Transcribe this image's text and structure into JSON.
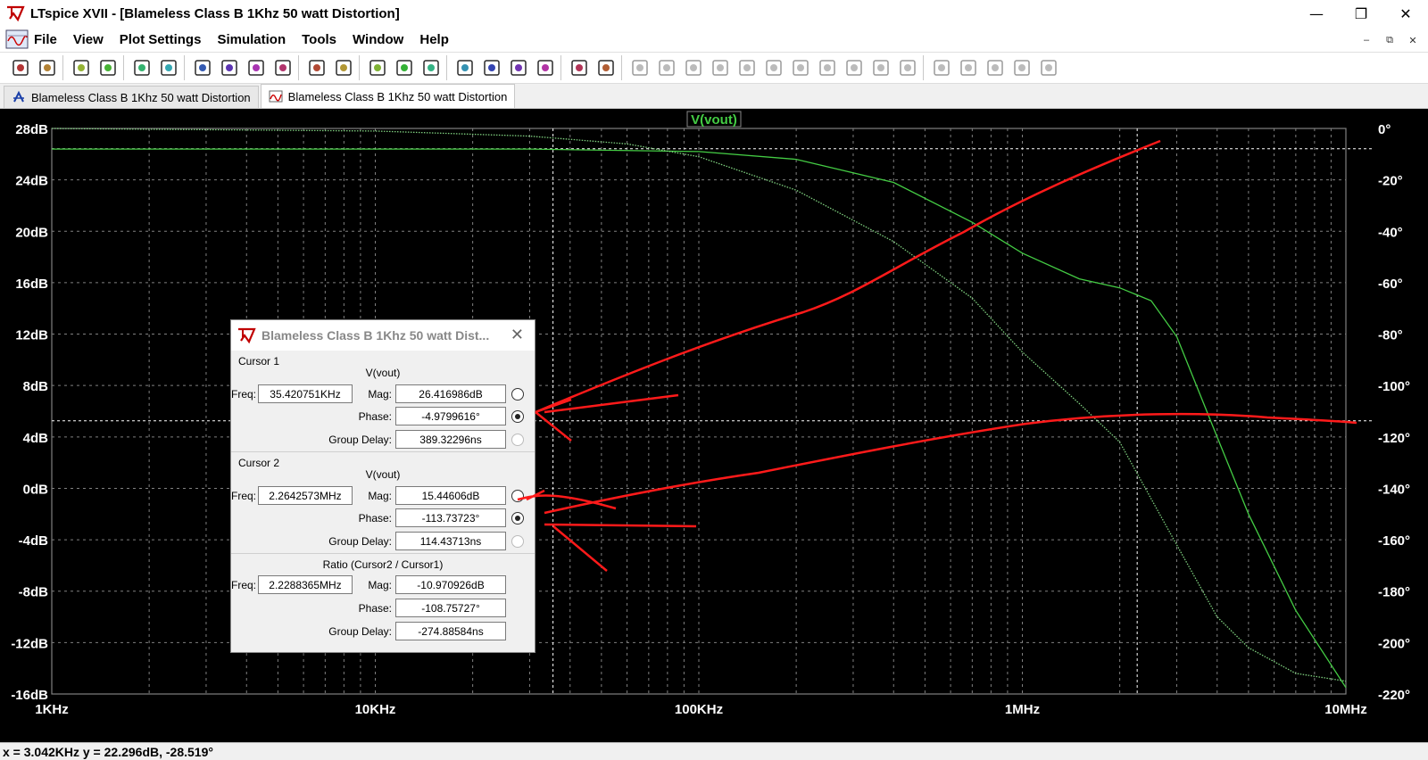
{
  "window": {
    "title": "LTspice XVII - [Blameless Class B 1Khz 50 watt Distortion]",
    "minimize": "—",
    "restore": "❐",
    "close": "✕"
  },
  "menu": {
    "items": [
      "File",
      "View",
      "Plot Settings",
      "Simulation",
      "Tools",
      "Window",
      "Help"
    ],
    "mdi_min": "–",
    "mdi_restore": "⧉",
    "mdi_close": "✕"
  },
  "toolbar": {
    "icons": [
      "new-schematic-icon",
      "open-icon",
      "save-icon",
      "control-panel-icon",
      "run-icon",
      "halt-icon",
      "zoom-in-icon",
      "zoom-full-icon",
      "zoom-out-icon",
      "zoom-cancel-icon",
      "autorange-icon",
      "pick-visible-icon",
      "tile-horizontal-icon",
      "cascade-icon",
      "tile-vertical-icon",
      "cut-icon",
      "copy-icon",
      "paste-icon",
      "find-icon",
      "print-setup-icon",
      "print-icon",
      "wire-icon",
      "ground-icon",
      "label-icon",
      "resistor-icon",
      "capacitor-icon",
      "inductor-icon",
      "diode-icon",
      "component-icon",
      "move-icon",
      "drag-icon",
      "undo-icon",
      "redo-icon",
      "rotate-icon",
      "mirror-icon",
      "text-icon",
      "spice-directive-icon"
    ]
  },
  "tabs": [
    {
      "label": "Blameless Class B 1Khz 50 watt Distortion",
      "icon": "schematic-icon",
      "active": false
    },
    {
      "label": "Blameless Class B 1Khz 50 watt Distortion",
      "icon": "waveform-icon",
      "active": true
    }
  ],
  "plot": {
    "trace_label": "V(vout)",
    "trace_color": "#44cc44",
    "phase_color": "#7fd07f",
    "grid_color": "#808080",
    "axis_text_color": "#ffffff"
  },
  "chart_data": {
    "type": "line",
    "title": "V(vout)",
    "x_scale": "log",
    "xlim": [
      1000,
      10000000
    ],
    "x_ticks": [
      "1KHz",
      "10KHz",
      "100KHz",
      "1MHz",
      "10MHz"
    ],
    "ylim_left": [
      -16,
      28
    ],
    "y_ticks_left": [
      "28dB",
      "24dB",
      "20dB",
      "16dB",
      "12dB",
      "8dB",
      "4dB",
      "0dB",
      "-4dB",
      "-8dB",
      "-12dB",
      "-16dB"
    ],
    "ylim_right": [
      -220,
      0
    ],
    "y_ticks_right": [
      "0°",
      "-20°",
      "-40°",
      "-60°",
      "-80°",
      "-100°",
      "-120°",
      "-140°",
      "-160°",
      "-180°",
      "-200°",
      "-220°"
    ],
    "grid": true,
    "series": [
      {
        "name": "V(vout)",
        "axis": "magnitude_dB",
        "style": "solid",
        "x": [
          1000,
          10000,
          30000,
          100000,
          200000,
          400000,
          700000,
          1000000,
          1500000,
          2000000,
          2500000,
          3000000,
          4000000,
          5000000,
          7000000,
          10000000
        ],
        "y": [
          26.4,
          26.4,
          26.4,
          26.2,
          25.6,
          23.8,
          20.7,
          18.3,
          16.3,
          15.6,
          14.6,
          11.8,
          4.0,
          -2.0,
          -9.5,
          -15.5
        ]
      },
      {
        "name": "V(vout)",
        "axis": "phase_deg",
        "style": "dotted",
        "x": [
          1000,
          10000,
          30000,
          60000,
          100000,
          200000,
          400000,
          700000,
          1000000,
          1500000,
          2000000,
          3000000,
          4000000,
          5000000,
          7000000,
          10000000
        ],
        "y": [
          0,
          -1,
          -3,
          -6,
          -11,
          -24,
          -44,
          -66,
          -87,
          -107,
          -122,
          -162,
          -190,
          -202,
          -212,
          -215
        ]
      }
    ],
    "cursor_lines": {
      "x": [
        35420.751,
        2264257.3
      ],
      "y_dB": [
        26.416986
      ],
      "y_deg": [
        -113.73723
      ]
    }
  },
  "statusbar": {
    "text": "x = 3.042KHz    y = 22.296dB, -28.519°"
  },
  "dialog": {
    "title": "Blameless Class B 1Khz 50 watt Dist...",
    "close": "✕",
    "cursor1": {
      "label": "Cursor 1",
      "trace": "V(vout)",
      "freq_label": "Freq:",
      "freq": "35.420751KHz",
      "mag_label": "Mag:",
      "mag": "26.416986dB",
      "phase_label": "Phase:",
      "phase": "-4.9799616°",
      "gd_label": "Group Delay:",
      "gd": "389.32296ns"
    },
    "cursor2": {
      "label": "Cursor 2",
      "trace": "V(vout)",
      "freq_label": "Freq:",
      "freq": "2.2642573MHz",
      "mag_label": "Mag:",
      "mag": "15.44606dB",
      "phase_label": "Phase:",
      "phase": "-113.73723°",
      "gd_label": "Group Delay:",
      "gd": "114.43713ns"
    },
    "ratio": {
      "label": "Ratio (Cursor2 / Cursor1)",
      "freq_label": "Freq:",
      "freq": "2.2288365MHz",
      "mag_label": "Mag:",
      "mag": "-10.970926dB",
      "phase_label": "Phase:",
      "phase": "-108.75727°",
      "gd_label": "Group Delay:",
      "gd": "-274.88584ns"
    }
  }
}
